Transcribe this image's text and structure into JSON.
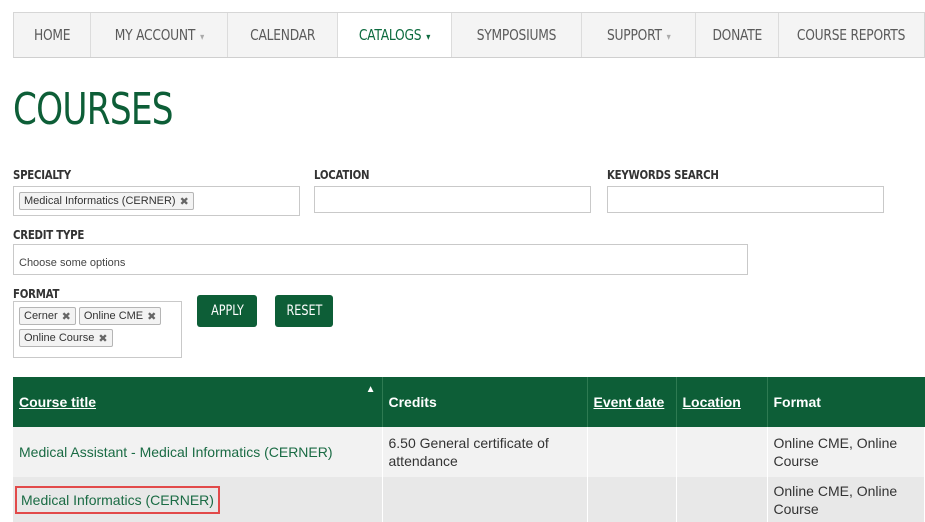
{
  "nav": {
    "items": [
      {
        "label": "HOME",
        "has_caret": false,
        "active": false
      },
      {
        "label": "MY ACCOUNT",
        "has_caret": true,
        "active": false
      },
      {
        "label": "CALENDAR",
        "has_caret": false,
        "active": false
      },
      {
        "label": "CATALOGS",
        "has_caret": true,
        "active": true
      },
      {
        "label": "SYMPOSIUMS",
        "has_caret": false,
        "active": false
      },
      {
        "label": "SUPPORT",
        "has_caret": true,
        "active": false
      },
      {
        "label": "DONATE",
        "has_caret": false,
        "active": false
      },
      {
        "label": "COURSE REPORTS",
        "has_caret": false,
        "active": false
      }
    ]
  },
  "page": {
    "title": "COURSES"
  },
  "filters": {
    "specialty": {
      "label": "SPECIALTY",
      "tags": [
        "Medical Informatics (CERNER)"
      ]
    },
    "location": {
      "label": "LOCATION",
      "value": ""
    },
    "keywords": {
      "label": "KEYWORDS SEARCH",
      "value": ""
    },
    "credit_type": {
      "label": "CREDIT TYPE",
      "placeholder": "Choose some options"
    },
    "format": {
      "label": "FORMAT",
      "tags": [
        "Cerner",
        "Online CME",
        "Online Course"
      ]
    },
    "apply_label": "APPLY",
    "reset_label": "RESET"
  },
  "table": {
    "headers": {
      "title": "Course title",
      "credits": "Credits",
      "event_date": "Event date",
      "location": "Location",
      "format": "Format"
    },
    "rows": [
      {
        "title": "Medical Assistant - Medical Informatics (CERNER)",
        "credits": "6.50 General certificate of attendance",
        "event_date": "",
        "location": "",
        "format": "Online CME, Online Course"
      },
      {
        "title": "Medical Informatics (CERNER)",
        "credits": "",
        "event_date": "",
        "location": "",
        "format": "Online CME, Online Course"
      }
    ]
  },
  "colors": {
    "brand_green": "#0d5e37",
    "highlight_red": "#e24a4a"
  }
}
